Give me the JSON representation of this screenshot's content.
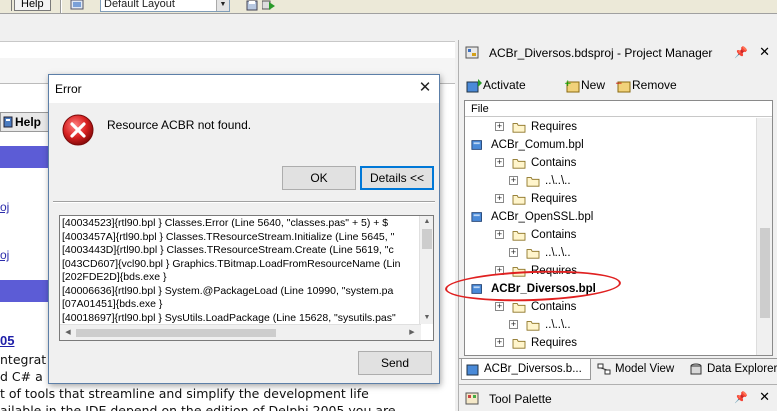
{
  "menubar": {
    "help_label": "Help"
  },
  "toolbar": {
    "layout_value": "Default Layout"
  },
  "left_pane": {
    "help_tab_label": "Help",
    "oj_1": "oj",
    "oj_2": "oj",
    "heading_num": "05",
    "lines": [
      "ntegrat",
      "d C# a",
      "t of tools that streamline and simplify the development life",
      "ailable in the IDE depend on the edition of Delphi 2005 you are"
    ]
  },
  "dialog": {
    "title": "Error",
    "close_glyph": "✕",
    "message": "Resource ACBR not found.",
    "ok_label": "OK",
    "details_label": "Details <<",
    "send_label": "Send",
    "log": [
      "[40034523]{rtl90.bpl   } Classes.Error (Line 5640, \"classes.pas\" + 5) + $",
      "[4003457A]{rtl90.bpl   } Classes.TResourceStream.Initialize (Line 5645, \"",
      "[4003443D]{rtl90.bpl   } Classes.TResourceStream.Create (Line 5619, \"c",
      "[043CD607]{vcl90.bpl   } Graphics.TBitmap.LoadFromResourceName (Lin",
      "[202FDE2D]{bds.exe     }",
      "[40006636]{rtl90.bpl   } System.@PackageLoad (Line 10990, \"system.pa",
      "[07A01451]{bds.exe     }",
      "[40018697]{rtl90.bpl   } SysUtils.LoadPackage (Line 15628, \"sysutils.pas\""
    ]
  },
  "project_manager": {
    "title": "ACBr_Diversos.bdsproj - Project Manager",
    "toolbar": {
      "activate": "Activate",
      "new": "New",
      "remove": "Remove"
    },
    "tree_header": "File",
    "rows": [
      {
        "label": "Requires",
        "kind": "folder",
        "level": 1
      },
      {
        "label": "ACBr_Comum.bpl",
        "kind": "package",
        "level": 0
      },
      {
        "label": "Contains",
        "kind": "folder",
        "level": 1
      },
      {
        "label": "..\\..\\..",
        "kind": "folder",
        "level": 2
      },
      {
        "label": "Requires",
        "kind": "folder",
        "level": 1
      },
      {
        "label": "ACBr_OpenSSL.bpl",
        "kind": "package",
        "level": 0
      },
      {
        "label": "Contains",
        "kind": "folder",
        "level": 1
      },
      {
        "label": "..\\..\\..",
        "kind": "folder",
        "level": 2
      },
      {
        "label": "Requires",
        "kind": "folder",
        "level": 1
      },
      {
        "label": "ACBr_Diversos.bpl",
        "kind": "package",
        "level": 0,
        "bold": true
      },
      {
        "label": "Contains",
        "kind": "folder",
        "level": 1
      },
      {
        "label": "..\\..\\..",
        "kind": "folder",
        "level": 2
      },
      {
        "label": "Requires",
        "kind": "folder",
        "level": 1
      }
    ],
    "tabs": {
      "project": "ACBr_Diversos.b...",
      "model": "Model View",
      "data": "Data Explorer"
    }
  },
  "tool_palette": {
    "title": "Tool Palette"
  },
  "colors": {
    "accent_red": "#e02020",
    "purple_bar": "#5c5cd6",
    "link": "#2d2dac"
  }
}
